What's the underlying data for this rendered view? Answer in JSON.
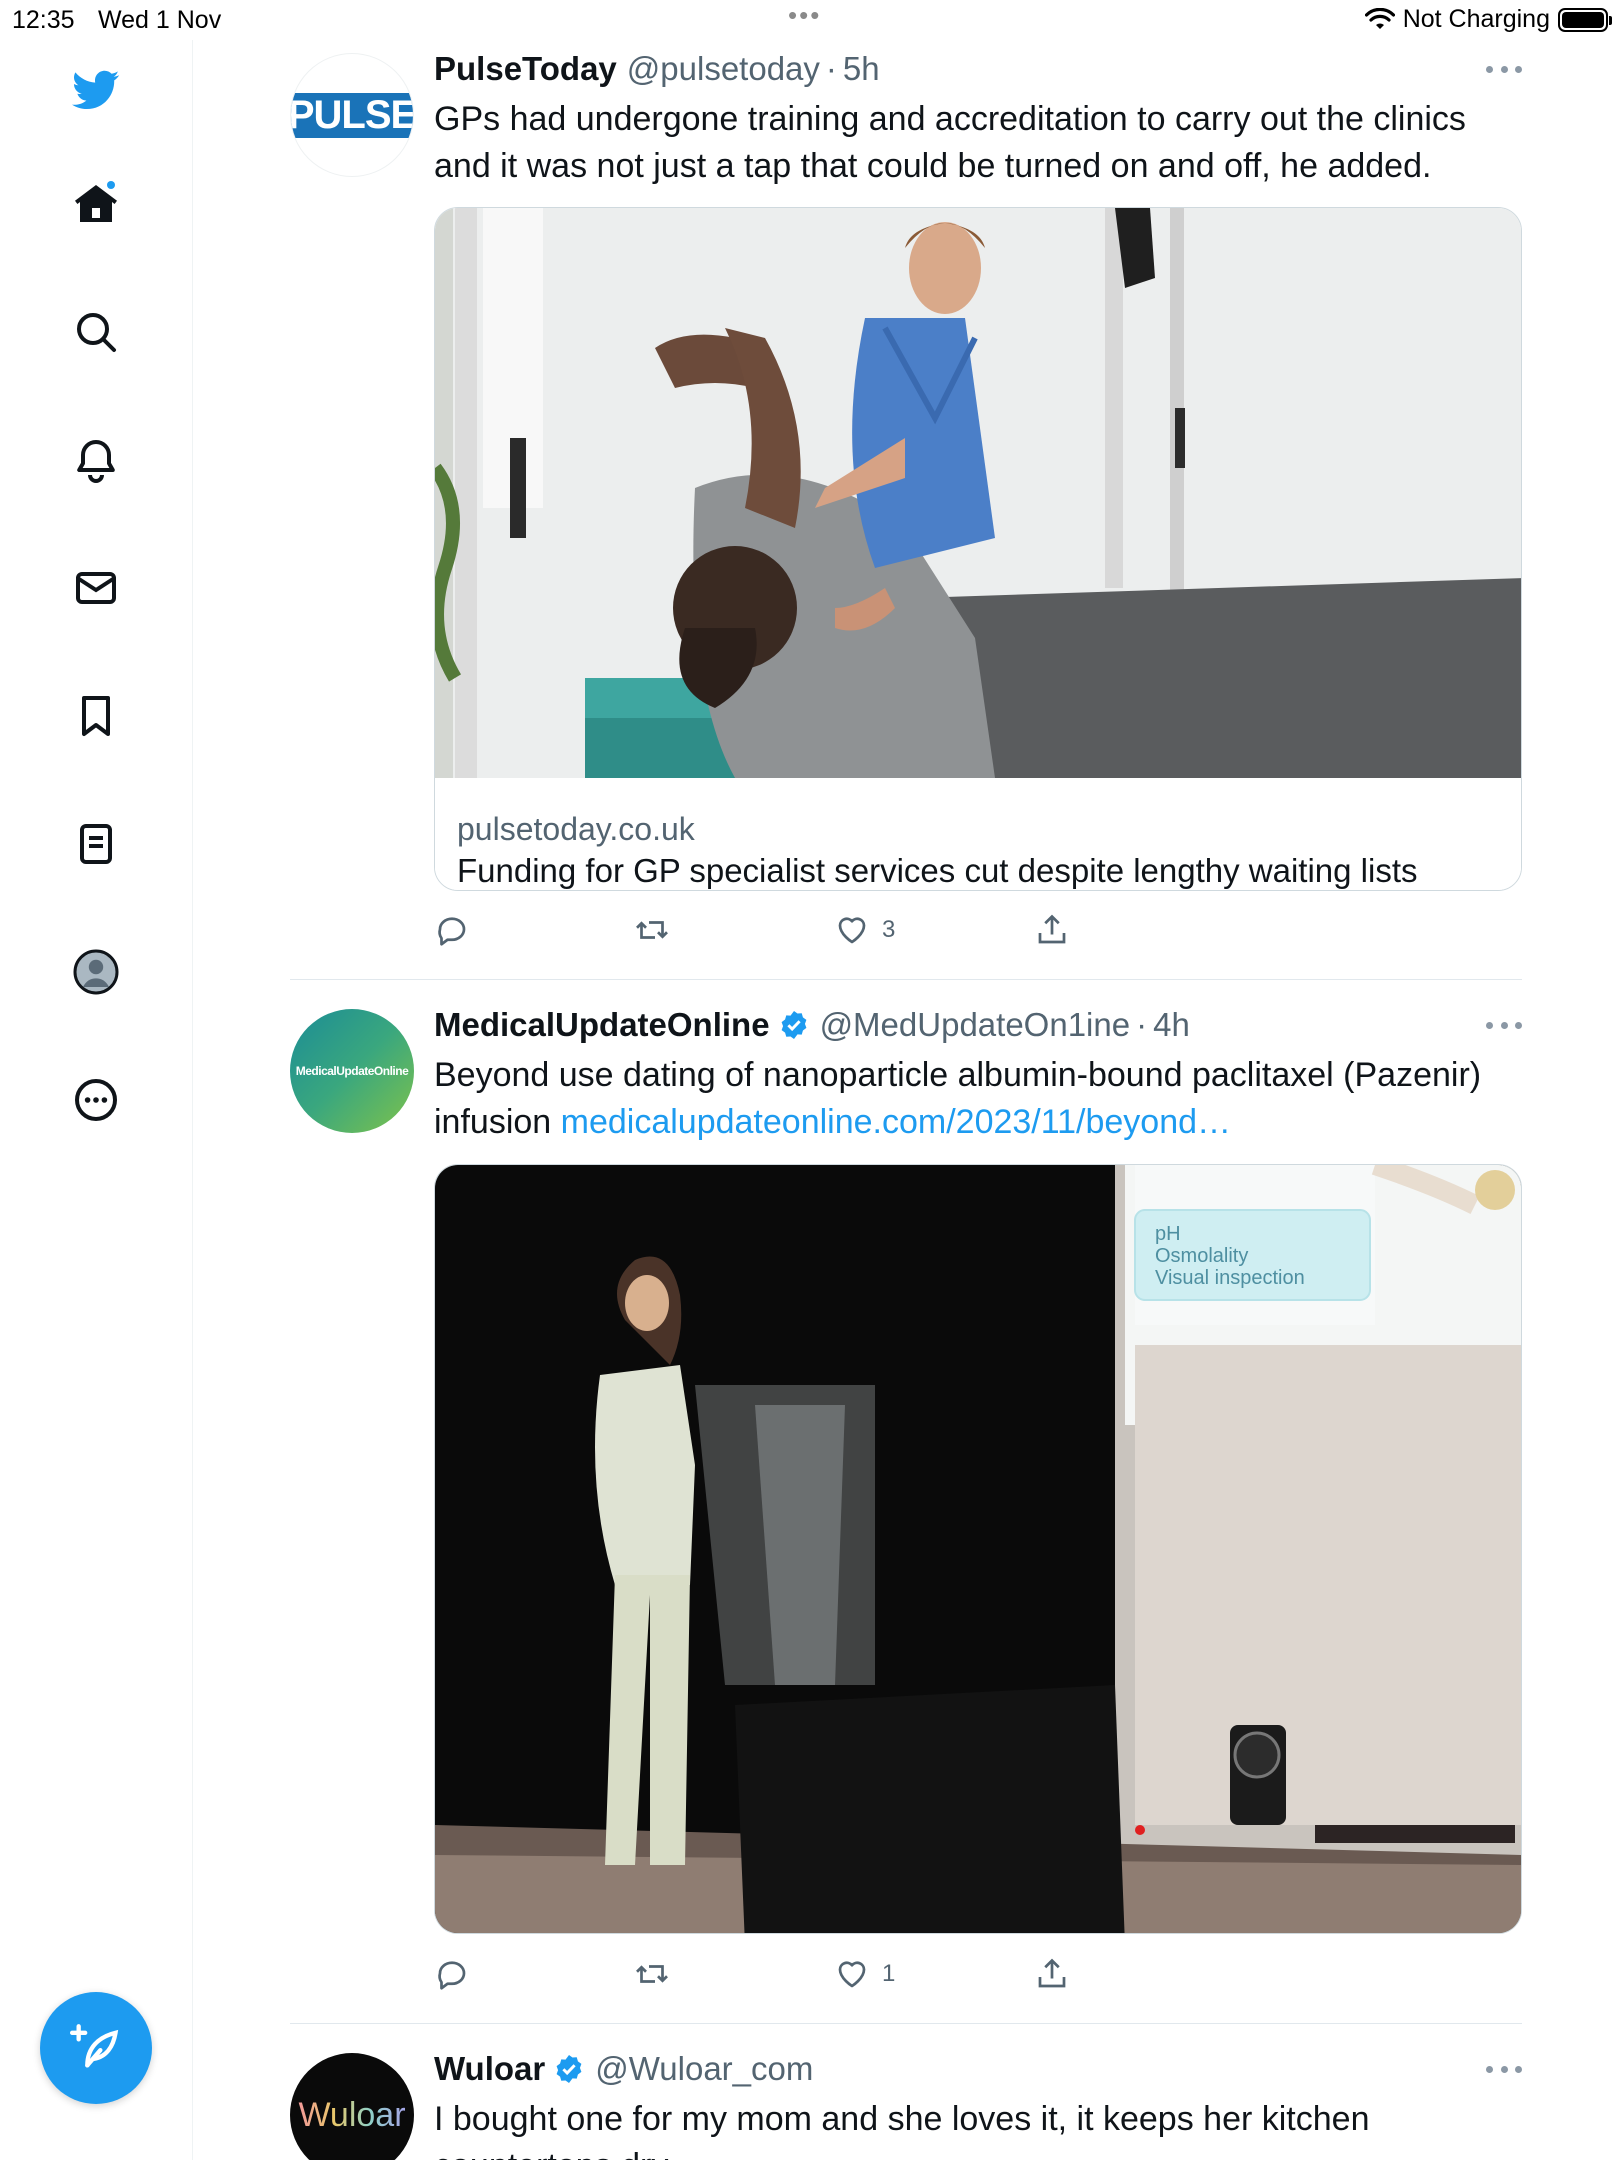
{
  "status_bar": {
    "time": "12:35",
    "date": "Wed 1 Nov",
    "battery_status": "Not Charging"
  },
  "sidebar": {
    "items": [
      {
        "icon": "twitter-bird-icon"
      },
      {
        "icon": "home-icon"
      },
      {
        "icon": "search-icon"
      },
      {
        "icon": "bell-icon"
      },
      {
        "icon": "mail-icon"
      },
      {
        "icon": "bookmark-icon"
      },
      {
        "icon": "lists-icon"
      },
      {
        "icon": "profile-icon"
      },
      {
        "icon": "more-circle-icon"
      }
    ],
    "compose_icon": "compose-tweet-icon",
    "accent": "#1d9bf0"
  },
  "tweets": [
    {
      "name": "PulseToday",
      "handle": "@pulsetoday",
      "time": "5h",
      "avatar_text": "PULSE",
      "verified": false,
      "text": "GPs had undergone training and accreditation to carry out the clinics and it was not just a tap that could be turned on and off, he added.",
      "card": {
        "domain": "pulsetoday.co.uk",
        "title": "Funding for GP specialist services cut despite lengthy waiting lists"
      },
      "likes": "3"
    },
    {
      "name": "MedicalUpdateOnline",
      "handle": "@MedUpdateOn1ine",
      "time": "4h",
      "avatar_text": "MedicalUpdateOnline",
      "verified": true,
      "text": "Beyond use dating of nanoparticle albumin-bound paclitaxel (Pazenir) infusion ",
      "link": "medicalupdateonline.com/2023/11/beyond…",
      "slide_text": [
        "pH",
        "Osmolality",
        "Visual inspection"
      ],
      "likes": "1"
    },
    {
      "name": "Wuloar",
      "handle": "@Wuloar_com",
      "avatar_text": "Wuloar",
      "verified": true,
      "text": "I bought one for my mom and she loves it, it keeps her kitchen countertops dry"
    }
  ]
}
